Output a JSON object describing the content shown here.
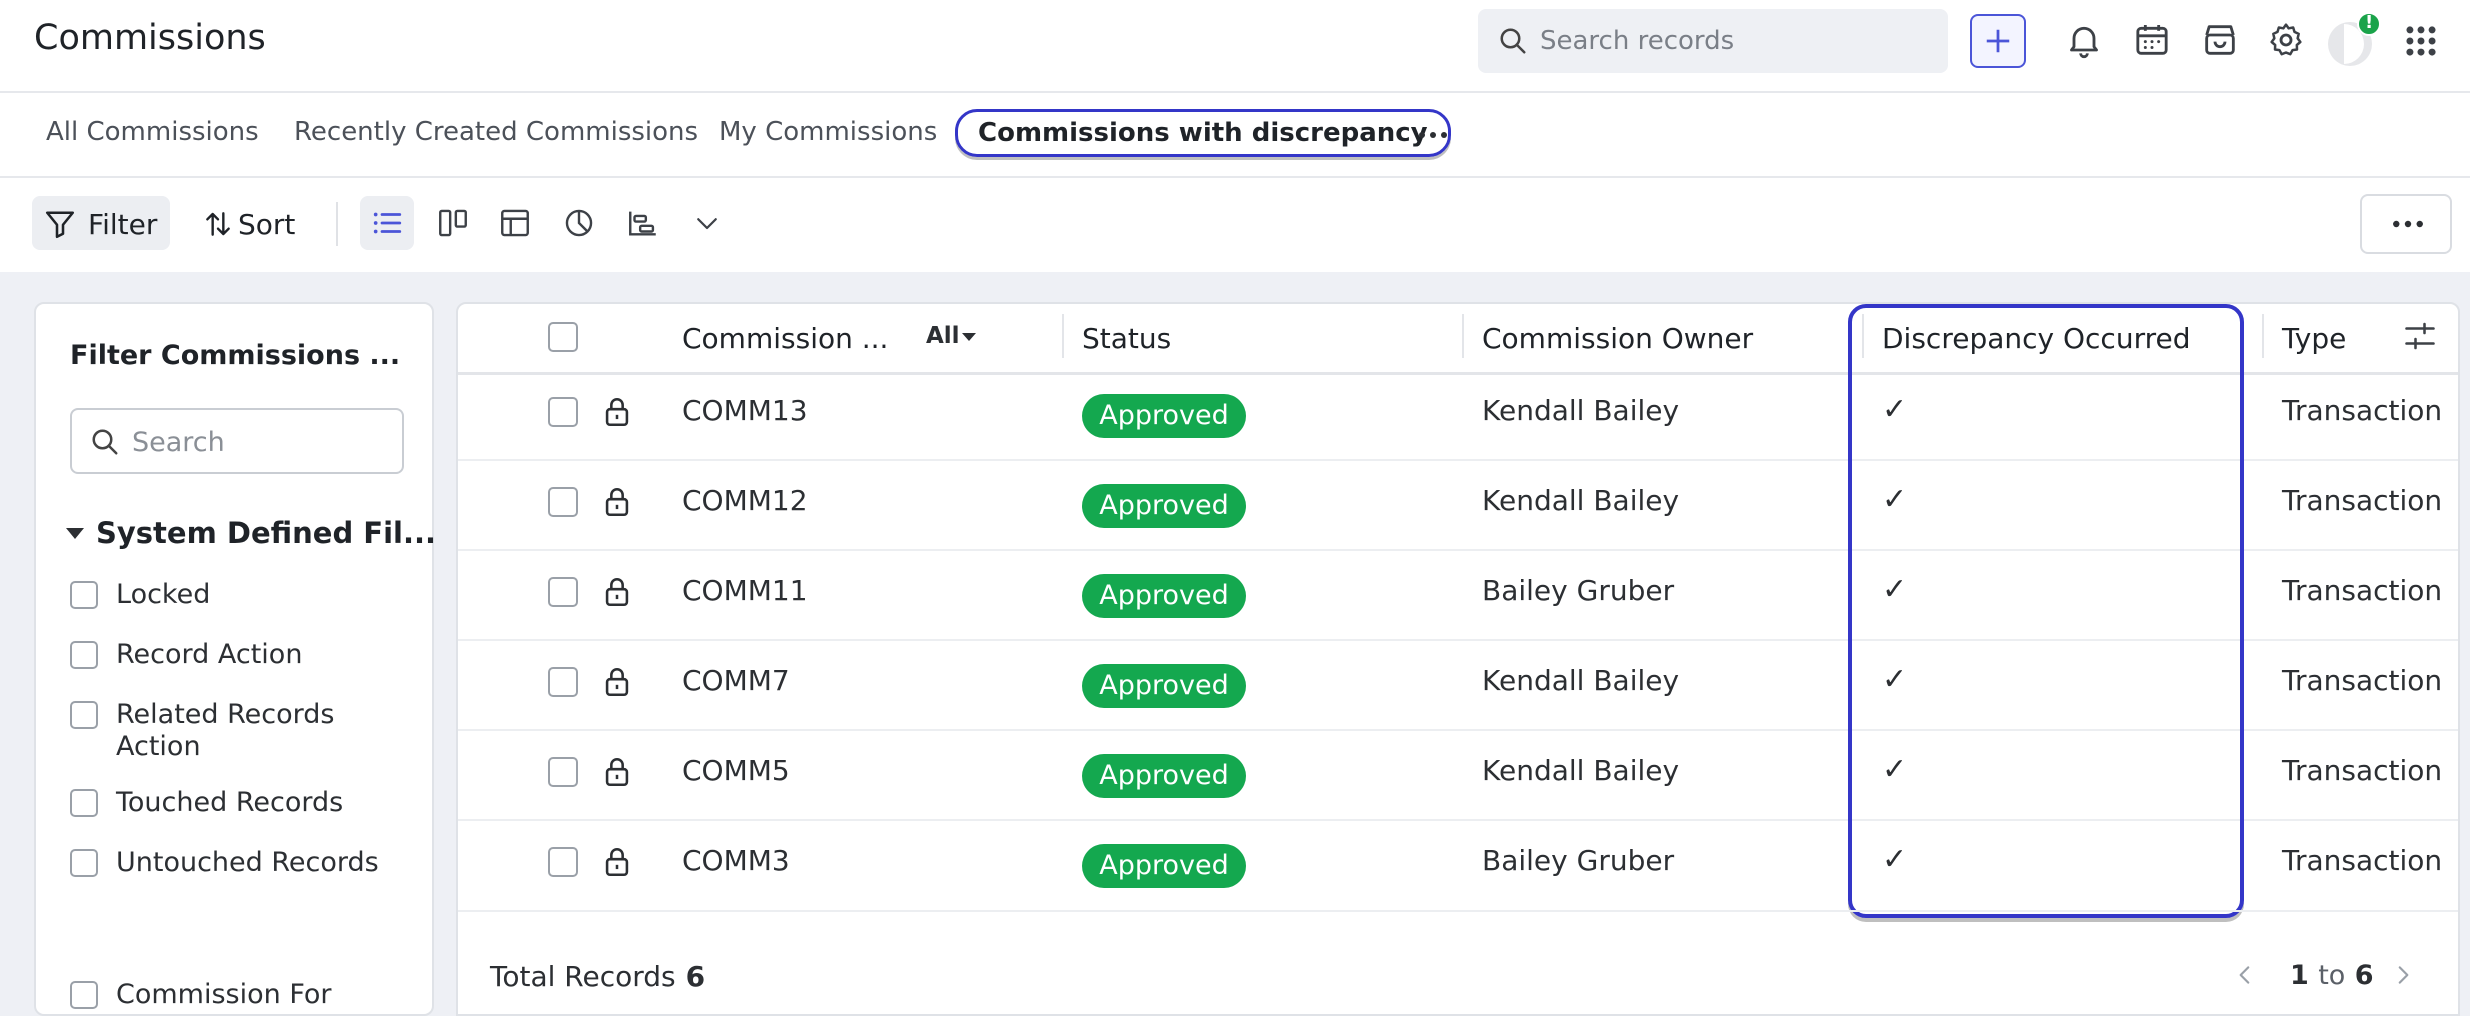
{
  "header": {
    "title": "Commissions",
    "search_placeholder": "Search records",
    "notification_badge": "!"
  },
  "tabs": [
    {
      "label": "All Commissions"
    },
    {
      "label": "Recently Created Commissions"
    },
    {
      "label": "My Commissions"
    },
    {
      "label": "Commissions with discrepancy",
      "active": true
    }
  ],
  "toolbar": {
    "filter_label": "Filter",
    "sort_label": "Sort"
  },
  "filter_panel": {
    "title": "Filter Commissions ...",
    "search_placeholder": "Search",
    "section_title": "System Defined Fil...",
    "items": [
      "Locked",
      "Record Action",
      "Related Records Action",
      "Touched Records",
      "Untouched Records",
      "Commission For"
    ]
  },
  "table": {
    "columns": {
      "name": "Commission ...",
      "name_filter": "All",
      "status": "Status",
      "owner": "Commission Owner",
      "discrepancy": "Discrepancy Occurred",
      "type": "Type"
    },
    "rows": [
      {
        "id": "COMM13",
        "status": "Approved",
        "owner": "Kendall Bailey",
        "discrepancy": "✓",
        "type": "Transaction"
      },
      {
        "id": "COMM12",
        "status": "Approved",
        "owner": "Kendall Bailey",
        "discrepancy": "✓",
        "type": "Transaction"
      },
      {
        "id": "COMM11",
        "status": "Approved",
        "owner": "Bailey Gruber",
        "discrepancy": "✓",
        "type": "Transaction"
      },
      {
        "id": "COMM7",
        "status": "Approved",
        "owner": "Kendall Bailey",
        "discrepancy": "✓",
        "type": "Transaction"
      },
      {
        "id": "COMM5",
        "status": "Approved",
        "owner": "Kendall Bailey",
        "discrepancy": "✓",
        "type": "Transaction"
      },
      {
        "id": "COMM3",
        "status": "Approved",
        "owner": "Bailey Gruber",
        "discrepancy": "✓",
        "type": "Transaction"
      }
    ],
    "footer": {
      "total_label": "Total Records",
      "total_count": "6",
      "range_start": "1",
      "range_sep": "to",
      "range_end": "6"
    }
  },
  "colors": {
    "accent": "#3436c8",
    "approved": "#14a84f",
    "status_alert": "#1aa34a"
  },
  "icons": [
    "search-icon",
    "plus-icon",
    "bell-icon",
    "calendar-icon",
    "store-icon",
    "gear-icon",
    "apps-grid-icon",
    "filter-icon",
    "sort-icon",
    "list-view-icon",
    "kanban-view-icon",
    "table-view-icon",
    "chart-view-icon",
    "timeline-view-icon",
    "chevron-down-icon",
    "more-icon",
    "lock-icon",
    "column-settings-icon",
    "chevron-left-icon",
    "chevron-right-icon"
  ]
}
